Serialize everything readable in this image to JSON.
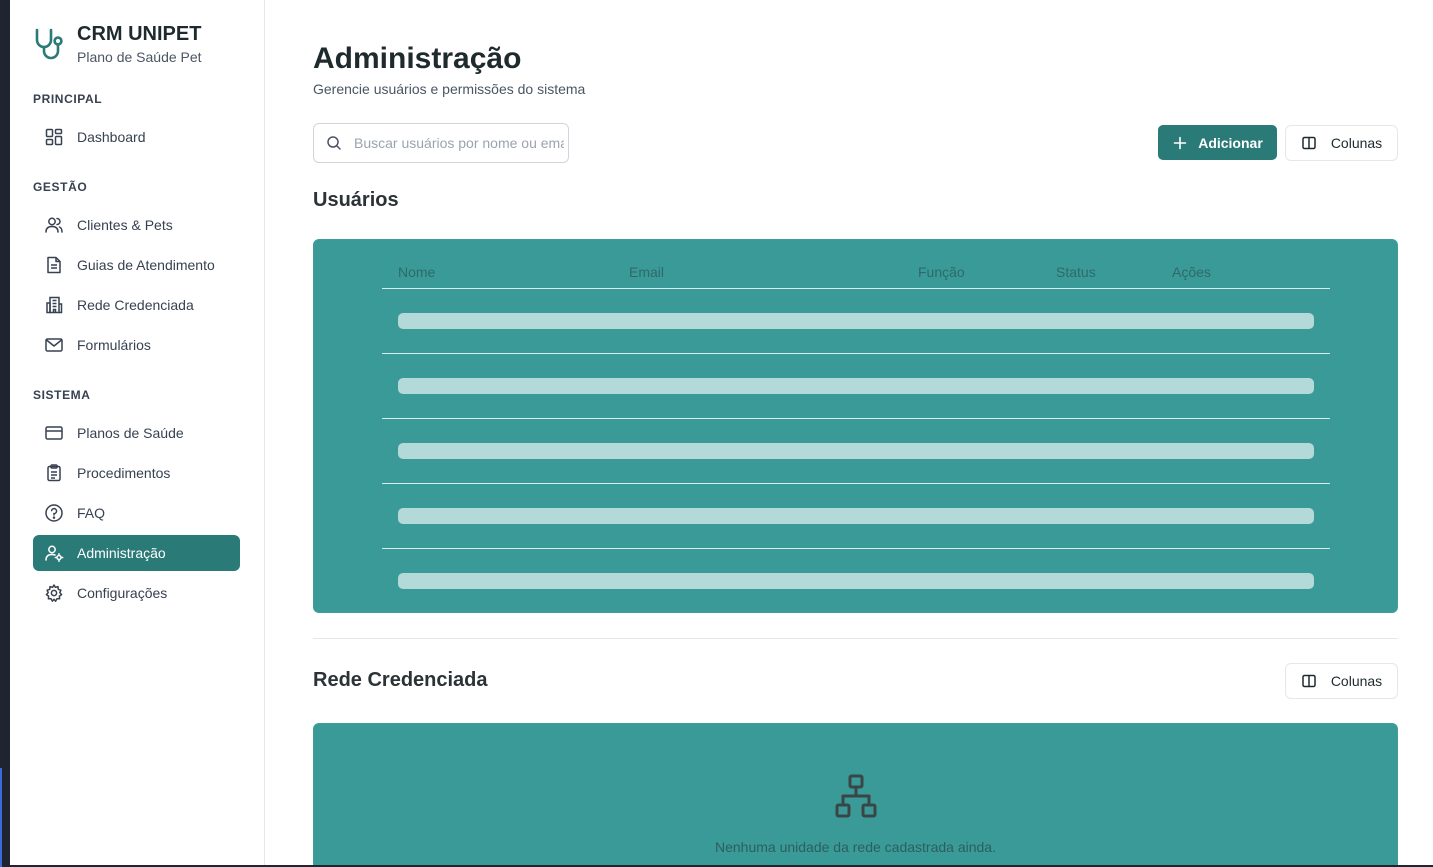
{
  "app": {
    "title": "CRM UNIPET",
    "subtitle": "Plano de Saúde Pet",
    "brand_icon": "stethoscope-icon",
    "accent_color": "#2a7a77",
    "table_color": "#3a9a98"
  },
  "sidebar": {
    "sections": [
      {
        "title": "PRINCIPAL"
      },
      {
        "title": "GESTÃO"
      },
      {
        "title": "SISTEMA"
      }
    ],
    "items": [
      {
        "label": "Dashboard",
        "icon": "dashboard-icon",
        "active": false
      },
      {
        "label": "Clientes & Pets",
        "icon": "users-icon",
        "active": false
      },
      {
        "label": "Guias de Atendimento",
        "icon": "file-text-icon",
        "active": false
      },
      {
        "label": "Rede Credenciada",
        "icon": "building-icon",
        "active": false
      },
      {
        "label": "Formulários",
        "icon": "mail-icon",
        "active": false
      },
      {
        "label": "Planos de Saúde",
        "icon": "credit-card-icon",
        "active": false
      },
      {
        "label": "Procedimentos",
        "icon": "clipboard-icon",
        "active": false
      },
      {
        "label": "FAQ",
        "icon": "help-circle-icon",
        "active": false
      },
      {
        "label": "Administração",
        "icon": "user-cog-icon",
        "active": true
      },
      {
        "label": "Configurações",
        "icon": "settings-icon",
        "active": false
      }
    ]
  },
  "main": {
    "title": "Administração",
    "subtitle": "Gerencie usuários e permissões do sistema",
    "search": {
      "placeholder": "Buscar usuários por nome ou email..."
    },
    "add_button": "Adicionar",
    "columns_button": "Colunas",
    "users_section": {
      "title": "Usuários",
      "columns": [
        "Nome",
        "Email",
        "Função",
        "Status",
        "Ações"
      ],
      "loading_rows": 5
    },
    "network_section": {
      "title": "Rede Credenciada",
      "columns_button": "Colunas",
      "empty_icon": "network-icon",
      "empty_text": "Nenhuma unidade da rede cadastrada ainda."
    }
  }
}
